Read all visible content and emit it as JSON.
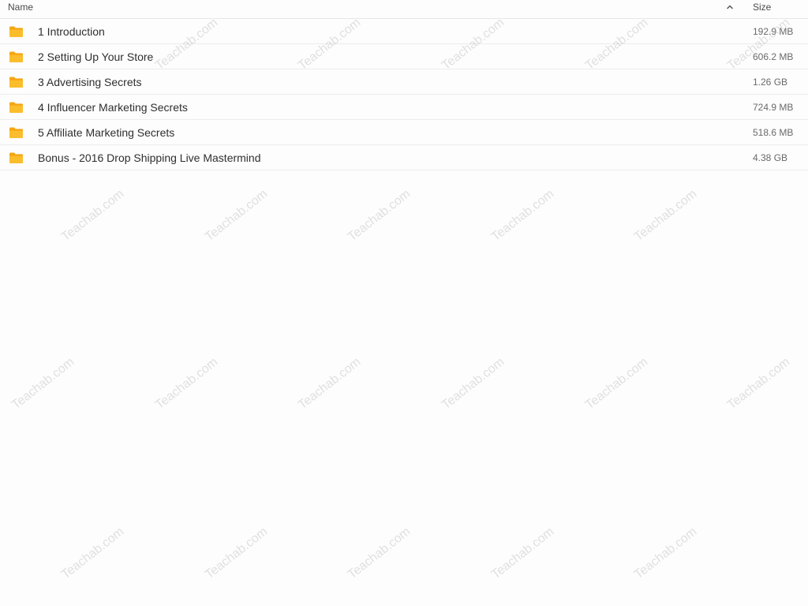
{
  "header": {
    "name_label": "Name",
    "size_label": "Size",
    "sort_icon": "chevron-up-icon"
  },
  "folder_color": "#f7b21a",
  "rows": [
    {
      "name": "1 Introduction",
      "size": "192.9 MB"
    },
    {
      "name": "2 Setting Up Your Store",
      "size": "606.2 MB"
    },
    {
      "name": "3 Advertising Secrets",
      "size": "1.26 GB"
    },
    {
      "name": "4 Influencer Marketing Secrets",
      "size": "724.9 MB"
    },
    {
      "name": "5 Affiliate Marketing Secrets",
      "size": "518.6 MB"
    },
    {
      "name": "Bonus - 2016 Drop Shipping Live Mastermind",
      "size": "4.38 GB"
    }
  ],
  "watermark": "Teachab.com"
}
